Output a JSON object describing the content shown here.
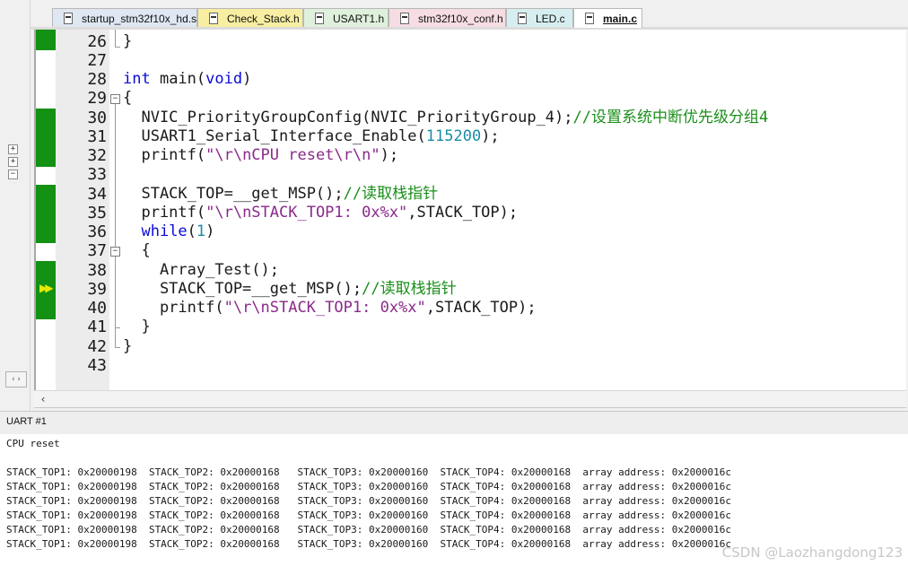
{
  "tabs": [
    {
      "label": "startup_stm32f10x_hd.s",
      "color": "#dfe7f2",
      "active": false
    },
    {
      "label": "Check_Stack.h",
      "color": "#f7eea2",
      "active": false
    },
    {
      "label": "USART1.h",
      "color": "#dff1dc",
      "active": false
    },
    {
      "label": "stm32f10x_conf.h",
      "color": "#f5dde3",
      "active": false
    },
    {
      "label": "LED.c",
      "color": "#d7eef0",
      "active": false
    },
    {
      "label": "main.c",
      "color": "#ffffff",
      "active": true
    }
  ],
  "editor": {
    "lines": [
      {
        "n": "26",
        "text": "}"
      },
      {
        "n": "27",
        "text": ""
      },
      {
        "n": "28",
        "text": "int main(void)"
      },
      {
        "n": "29",
        "text": "{"
      },
      {
        "n": "30",
        "text": "  NVIC_PriorityGroupConfig(NVIC_PriorityGroup_4);//设置系统中断优先级分组4"
      },
      {
        "n": "31",
        "text": "  USART1_Serial_Interface_Enable(115200);"
      },
      {
        "n": "32",
        "text": "  printf(\"\\r\\nCPU reset\\r\\n\");"
      },
      {
        "n": "33",
        "text": ""
      },
      {
        "n": "34",
        "text": "  STACK_TOP=__get_MSP();//读取栈指针"
      },
      {
        "n": "35",
        "text": "  printf(\"\\r\\nSTACK_TOP1: 0x%x\",STACK_TOP);"
      },
      {
        "n": "36",
        "text": "  while(1)"
      },
      {
        "n": "37",
        "text": "  {"
      },
      {
        "n": "38",
        "text": "    Array_Test();"
      },
      {
        "n": "39",
        "text": "    STACK_TOP=__get_MSP();//读取栈指针"
      },
      {
        "n": "40",
        "text": "    printf(\"\\r\\nSTACK_TOP1: 0x%x\",STACK_TOP);"
      },
      {
        "n": "41",
        "text": "  }"
      },
      {
        "n": "42",
        "text": "}"
      },
      {
        "n": "43",
        "text": ""
      }
    ],
    "current_line": "39",
    "coverage_color": "#139113",
    "exec_marker_color": "#e8e800"
  },
  "output": {
    "title": "UART #1",
    "lines": [
      "CPU reset",
      "",
      "STACK_TOP1: 0x20000198  STACK_TOP2: 0x20000168   STACK_TOP3: 0x20000160  STACK_TOP4: 0x20000168  array address: 0x2000016c",
      "STACK_TOP1: 0x20000198  STACK_TOP2: 0x20000168   STACK_TOP3: 0x20000160  STACK_TOP4: 0x20000168  array address: 0x2000016c",
      "STACK_TOP1: 0x20000198  STACK_TOP2: 0x20000168   STACK_TOP3: 0x20000160  STACK_TOP4: 0x20000168  array address: 0x2000016c",
      "STACK_TOP1: 0x20000198  STACK_TOP2: 0x20000168   STACK_TOP3: 0x20000160  STACK_TOP4: 0x20000168  array address: 0x2000016c",
      "STACK_TOP1: 0x20000198  STACK_TOP2: 0x20000168   STACK_TOP3: 0x20000160  STACK_TOP4: 0x20000168  array address: 0x2000016c",
      "STACK_TOP1: 0x20000198  STACK_TOP2: 0x20000168   STACK_TOP3: 0x20000160  STACK_TOP4: 0x20000168  array address: 0x2000016c"
    ],
    "watermark": "CSDN @Laozhangdong123"
  },
  "icons": {
    "tree_expand": "+",
    "tree_collapse": "−",
    "fold_collapse": "−",
    "scroll_left": "‹",
    "left_scroll": "‹ ›",
    "exec_arrow": "▶▶"
  }
}
